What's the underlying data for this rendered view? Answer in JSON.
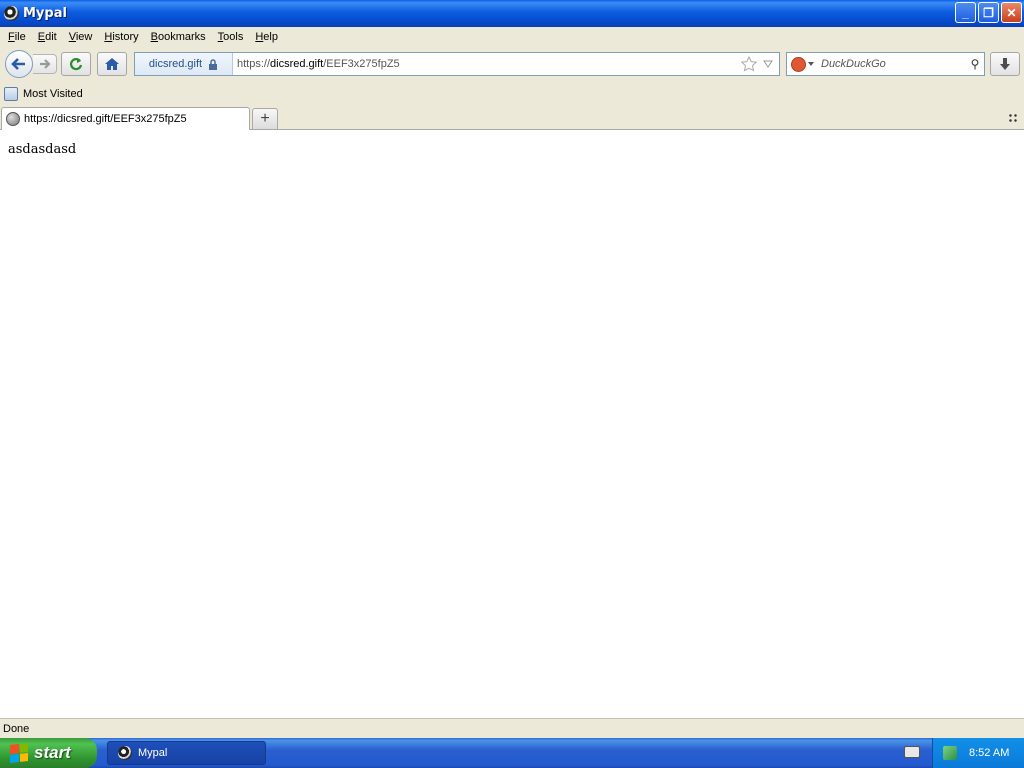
{
  "window": {
    "title": "Mypal",
    "controls": {
      "minimize": "_",
      "restore": "❐",
      "close": "✕"
    }
  },
  "menu": {
    "items": [
      {
        "accel": "F",
        "rest": "ile"
      },
      {
        "accel": "E",
        "rest": "dit"
      },
      {
        "accel": "V",
        "rest": "iew"
      },
      {
        "accel": "H",
        "rest": "istory"
      },
      {
        "accel": "B",
        "rest": "ookmarks"
      },
      {
        "accel": "T",
        "rest": "ools"
      },
      {
        "accel": "H",
        "rest": "elp"
      }
    ]
  },
  "toolbar": {
    "site_identity": "dicsred.gift",
    "url_scheme": "https://",
    "url_host": "dicsred.gift",
    "url_path": "/EEF3x275fpZ5",
    "search_placeholder": "DuckDuckGo"
  },
  "bookmarks": {
    "most_visited": "Most Visited"
  },
  "tabs": {
    "active_title": "https://dicsred.gift/EEF3x275fpZ5",
    "new_tab": "+"
  },
  "content": {
    "text": "asdasdasd"
  },
  "status": {
    "text": "Done"
  },
  "taskbar": {
    "start_label": "start",
    "task_label": "Mypal",
    "clock": "8:52 AM"
  },
  "colors": {
    "titlebar": "#0b5ce0",
    "chrome": "#ece9d8",
    "start_green": "#3d9b3d",
    "taskbar_blue": "#245ad0"
  },
  "icons": [
    "app-icon",
    "back-icon",
    "forward-icon",
    "reload-icon",
    "home-icon",
    "lock-icon",
    "star-icon",
    "dropdown-icon",
    "duckduckgo-icon",
    "search-icon",
    "download-icon",
    "bookmark-folder-icon",
    "globe-icon",
    "tab-list-icon",
    "windows-flag-icon",
    "keyboard-icon",
    "network-icon"
  ]
}
